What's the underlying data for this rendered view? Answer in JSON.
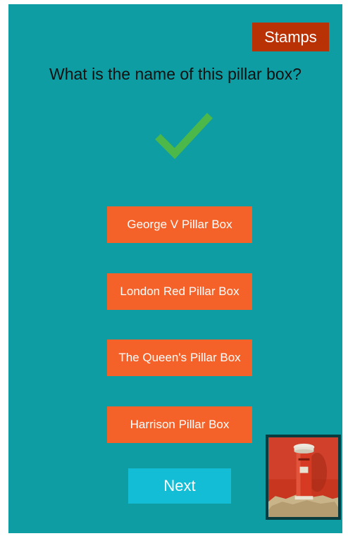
{
  "header": {
    "stamps_label": "Stamps"
  },
  "quiz": {
    "question": "What is the name of this pillar box?",
    "result_icon": "checkmark-icon",
    "answers": [
      "George V Pillar Box",
      "London Red Pillar Box",
      "The Queen's Pillar Box",
      "Harrison Pillar Box"
    ],
    "next_label": "Next"
  },
  "image": {
    "subject": "red-pillar-box-photo"
  },
  "colors": {
    "background": "#0e9da3",
    "stamps_button": "#b83206",
    "answer_button": "#f4622a",
    "next_button": "#13bdd6",
    "checkmark": "#4cb84a"
  }
}
